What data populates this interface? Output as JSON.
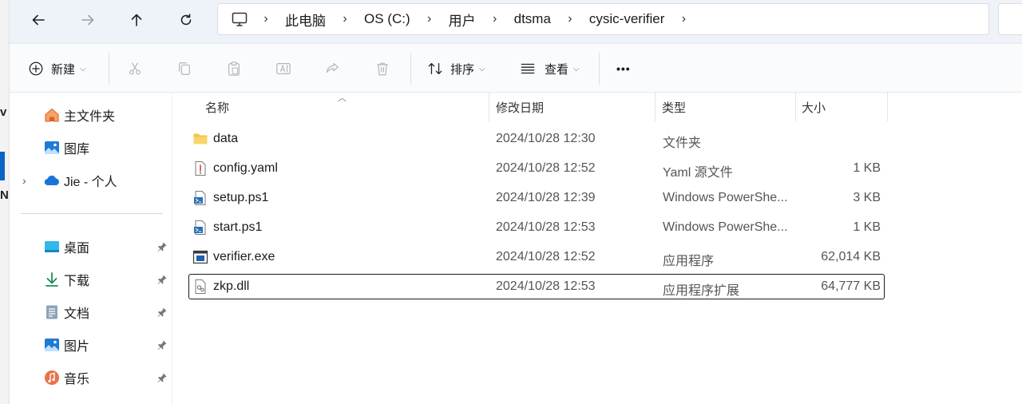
{
  "address_bar": {
    "breadcrumbs": [
      "此电脑",
      "OS (C:)",
      "用户",
      "dtsma",
      "cysic-verifier"
    ]
  },
  "toolbar": {
    "new_label": "新建",
    "sort_label": "排序",
    "view_label": "查看",
    "more_label": "•••"
  },
  "sidebar": {
    "items": [
      {
        "label": "主文件夹",
        "icon": "home-icon"
      },
      {
        "label": "图库",
        "icon": "gallery-icon"
      },
      {
        "label": "Jie - 个人",
        "icon": "cloud-icon"
      },
      {
        "label": "桌面",
        "icon": "desktop-icon",
        "pinned": true
      },
      {
        "label": "下载",
        "icon": "download-icon",
        "pinned": true
      },
      {
        "label": "文档",
        "icon": "documents-icon",
        "pinned": true
      },
      {
        "label": "图片",
        "icon": "pictures-icon",
        "pinned": true
      },
      {
        "label": "音乐",
        "icon": "music-icon",
        "pinned": true
      }
    ]
  },
  "file_list": {
    "columns": [
      "名称",
      "修改日期",
      "类型",
      "大小"
    ],
    "rows": [
      {
        "name": "data",
        "modified": "2024/10/28 12:30",
        "type": "文件夹",
        "size": "",
        "icon": "folder-icon"
      },
      {
        "name": "config.yaml",
        "modified": "2024/10/28 12:52",
        "type": "Yaml 源文件",
        "size": "1 KB",
        "icon": "yaml-file-icon"
      },
      {
        "name": "setup.ps1",
        "modified": "2024/10/28 12:39",
        "type": "Windows PowerShe...",
        "size": "3 KB",
        "icon": "powershell-file-icon"
      },
      {
        "name": "start.ps1",
        "modified": "2024/10/28 12:53",
        "type": "Windows PowerShe...",
        "size": "1 KB",
        "icon": "powershell-file-icon"
      },
      {
        "name": "verifier.exe",
        "modified": "2024/10/28 12:52",
        "type": "应用程序",
        "size": "62,014 KB",
        "icon": "exe-file-icon"
      },
      {
        "name": "zkp.dll",
        "modified": "2024/10/28 12:53",
        "type": "应用程序扩展",
        "size": "64,777 KB",
        "icon": "dll-file-icon",
        "focused": true
      }
    ]
  },
  "colors": {
    "accent": "#0a64c4",
    "folder": "#f6c342",
    "address_bg": "#eef3f9"
  }
}
